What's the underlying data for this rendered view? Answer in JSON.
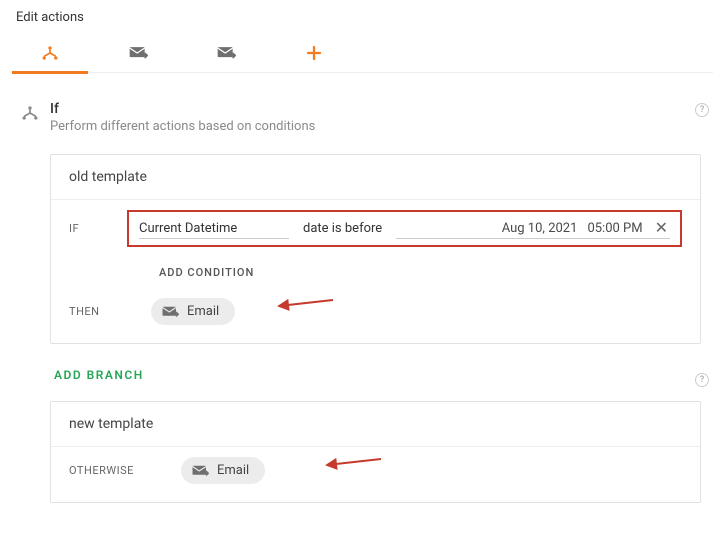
{
  "header": {
    "title": "Edit actions"
  },
  "if_section": {
    "title": "If",
    "subtitle": "Perform different actions based on conditions"
  },
  "branch1": {
    "name": "old template",
    "if_label": "IF",
    "condition": {
      "field": "Current Datetime",
      "operator": "date is before",
      "date": "Aug 10, 2021",
      "time": "05:00 PM"
    },
    "add_condition": "ADD CONDITION",
    "then_label": "THEN",
    "action_label": "Email"
  },
  "add_branch": "ADD BRANCH",
  "branch2": {
    "name": "new template",
    "otherwise_label": "OTHERWISE",
    "action_label": "Email"
  },
  "help_glyph": "?"
}
